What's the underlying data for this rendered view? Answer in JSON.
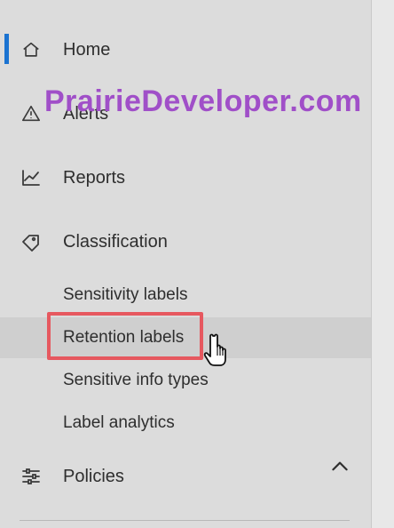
{
  "nav": {
    "home_label": "Home",
    "alerts_label": "Alerts",
    "reports_label": "Reports",
    "classification_label": "Classification",
    "policies_label": "Policies",
    "classification_children": [
      "Sensitivity labels",
      "Retention labels",
      "Sensitive info types",
      "Label analytics"
    ]
  },
  "overlay": {
    "watermark_text": "PrairieDeveloper.com"
  },
  "colors": {
    "accent_bar": "#1b73d1",
    "highlight_box": "#e6585f",
    "watermark": "#a04fc8"
  },
  "icons": {
    "home": "home-icon",
    "alerts": "warning-icon",
    "reports": "line-chart-icon",
    "classification": "tag-icon",
    "policies": "sliders-icon",
    "classification_expand": "chevron-up-icon",
    "cursor": "hand-cursor-icon"
  }
}
